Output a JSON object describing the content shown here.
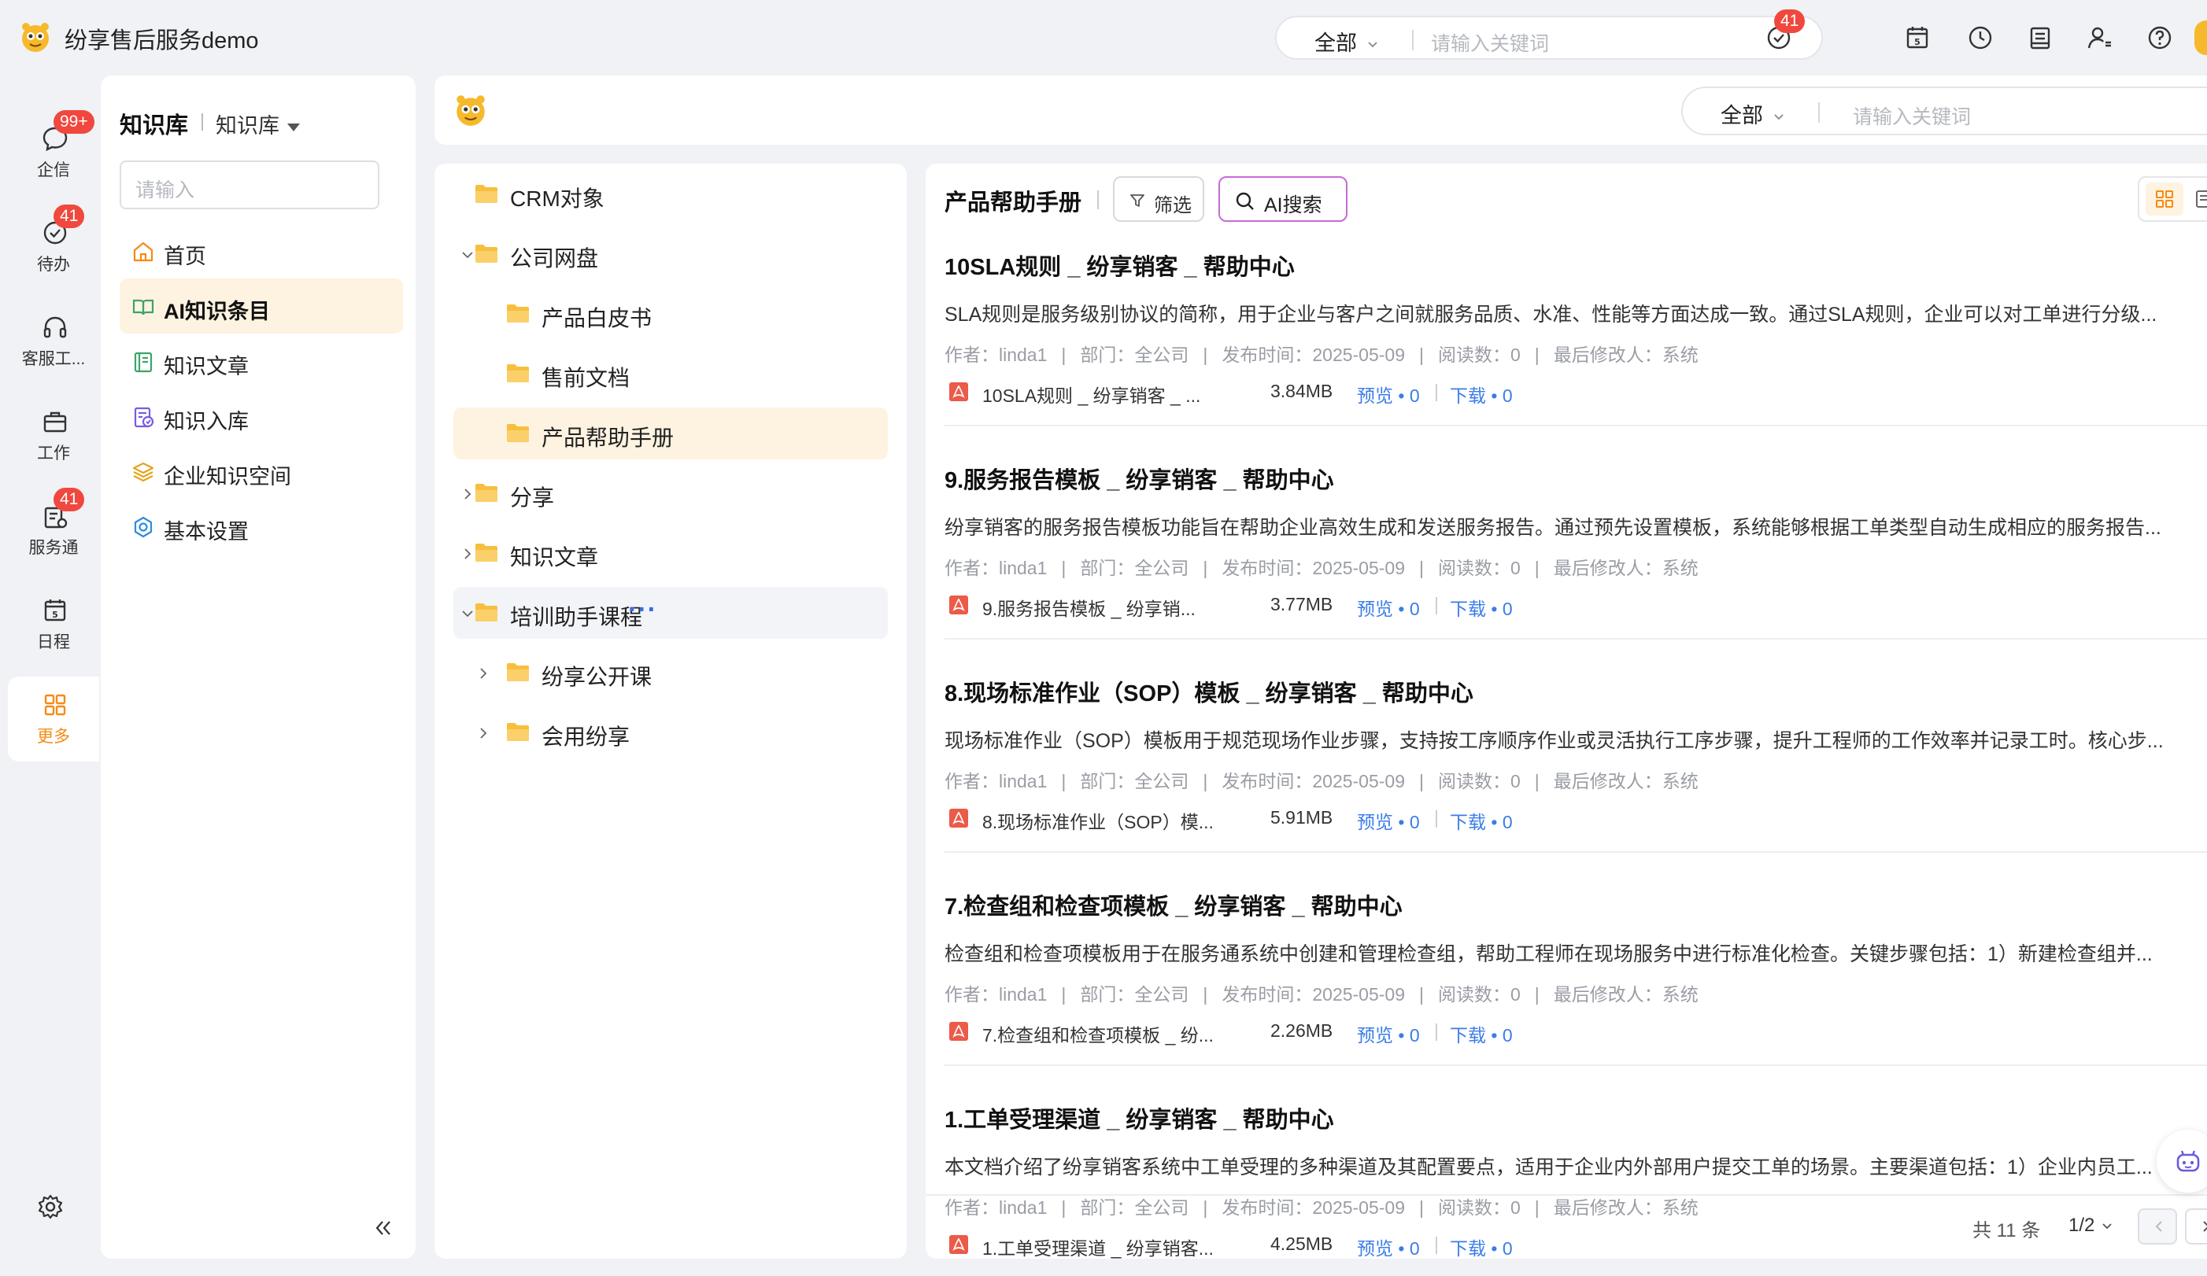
{
  "app": {
    "title": "纷享售后服务demo"
  },
  "top_search": {
    "scope": "全部",
    "placeholder": "请输入关键词"
  },
  "top_icons": [
    {
      "name": "todo-check-icon",
      "badge": "41"
    },
    {
      "name": "calendar-icon",
      "badge": ""
    },
    {
      "name": "clock-icon",
      "badge": ""
    },
    {
      "name": "notes-icon",
      "badge": ""
    },
    {
      "name": "user-settings-icon",
      "badge": ""
    },
    {
      "name": "help-icon",
      "badge": ""
    }
  ],
  "rail": [
    {
      "label": "企信",
      "icon": "chat-icon",
      "badge": "99+"
    },
    {
      "label": "待办",
      "icon": "todo-check-icon",
      "badge": "41"
    },
    {
      "label": "客服工...",
      "icon": "headset-icon",
      "badge": ""
    },
    {
      "label": "工作",
      "icon": "briefcase-icon",
      "badge": ""
    },
    {
      "label": "服务通",
      "icon": "service-icon",
      "badge": "41"
    },
    {
      "label": "日程",
      "icon": "calendar-icon",
      "badge": ""
    },
    {
      "label": "更多",
      "icon": "grid-icon",
      "badge": ""
    }
  ],
  "nav": {
    "title": "知识库",
    "subtitle": "知识库",
    "search_placeholder": "请输入",
    "items": [
      {
        "label": "首页",
        "icon": "home-icon"
      },
      {
        "label": "AI知识条目",
        "icon": "book-open-icon",
        "active": true
      },
      {
        "label": "知识文章",
        "icon": "article-icon"
      },
      {
        "label": "知识入库",
        "icon": "import-icon"
      },
      {
        "label": "企业知识空间",
        "icon": "layers-icon"
      },
      {
        "label": "基本设置",
        "icon": "settings-icon"
      }
    ]
  },
  "header_search": {
    "scope": "全部",
    "placeholder": "请输入关键词"
  },
  "tree": [
    {
      "label": "CRM对象",
      "level": 0,
      "caret": ""
    },
    {
      "label": "公司网盘",
      "level": 0,
      "caret": "down"
    },
    {
      "label": "产品白皮书",
      "level": 1,
      "caret": ""
    },
    {
      "label": "售前文档",
      "level": 1,
      "caret": ""
    },
    {
      "label": "产品帮助手册",
      "level": 1,
      "caret": "",
      "state": "active"
    },
    {
      "label": "分享",
      "level": 0,
      "caret": "right"
    },
    {
      "label": "知识文章",
      "level": 0,
      "caret": "right"
    },
    {
      "label": "培训助手课程",
      "level": 0,
      "caret": "down",
      "state": "hover",
      "more": "···"
    },
    {
      "label": "纷享公开课",
      "level": 1,
      "caret": "right"
    },
    {
      "label": "会用纷享",
      "level": 1,
      "caret": "right"
    }
  ],
  "list": {
    "title": "产品帮助手册",
    "filter_label": "筛选",
    "ai_label": "AI搜索",
    "meta_labels": {
      "author": "作者：",
      "dept": "部门：",
      "date": "发布时间：",
      "reads": "阅读数：",
      "modifier": "最后修改人：",
      "sep": "|"
    },
    "docs": [
      {
        "title": "10SLA规则 _ 纷享销客 _ 帮助中心",
        "summary": "SLA规则是服务级别协议的简称，用于企业与客户之间就服务品质、水准、性能等方面达成一致。通过SLA规则，企业可以对工单进行分级...",
        "author": "linda1",
        "dept": "全公司",
        "date": "2025-05-09",
        "reads": "0",
        "modifier": "系统",
        "file": "10SLA规则 _ 纷享销客 _ ...",
        "size": "3.84MB",
        "preview": "预览 • 0",
        "download": "下载 • 0"
      },
      {
        "title": "9.服务报告模板 _ 纷享销客 _ 帮助中心",
        "summary": "纷享销客的服务报告模板功能旨在帮助企业高效生成和发送服务报告。通过预先设置模板，系统能够根据工单类型自动生成相应的服务报告...",
        "author": "linda1",
        "dept": "全公司",
        "date": "2025-05-09",
        "reads": "0",
        "modifier": "系统",
        "file": "9.服务报告模板 _ 纷享销...",
        "size": "3.77MB",
        "preview": "预览 • 0",
        "download": "下载 • 0"
      },
      {
        "title": "8.现场标准作业（SOP）模板 _ 纷享销客 _ 帮助中心",
        "summary": "现场标准作业（SOP）模板用于规范现场作业步骤，支持按工序顺序作业或灵活执行工序步骤，提升工程师的工作效率并记录工时。核心步...",
        "author": "linda1",
        "dept": "全公司",
        "date": "2025-05-09",
        "reads": "0",
        "modifier": "系统",
        "file": "8.现场标准作业（SOP）模...",
        "size": "5.91MB",
        "preview": "预览 • 0",
        "download": "下载 • 0"
      },
      {
        "title": "7.检查组和检查项模板 _ 纷享销客 _ 帮助中心",
        "summary": "检查组和检查项模板用于在服务通系统中创建和管理检查组，帮助工程师在现场服务中进行标准化检查。关键步骤包括：1）新建检查组并...",
        "author": "linda1",
        "dept": "全公司",
        "date": "2025-05-09",
        "reads": "0",
        "modifier": "系统",
        "file": "7.检查组和检查项模板 _ 纷...",
        "size": "2.26MB",
        "preview": "预览 • 0",
        "download": "下载 • 0"
      },
      {
        "title": "1.工单受理渠道 _ 纷享销客 _ 帮助中心",
        "summary": "本文档介绍了纷享销客系统中工单受理的多种渠道及其配置要点，适用于企业内外部用户提交工单的场景。主要渠道包括：1）企业内员工...",
        "author": "linda1",
        "dept": "全公司",
        "date": "2025-05-09",
        "reads": "0",
        "modifier": "系统",
        "file": "1.工单受理渠道 _ 纷享销客...",
        "size": "4.25MB",
        "preview": "预览 • 0",
        "download": "下载 • 0"
      }
    ],
    "pager": {
      "total": "共 11 条",
      "page": "1/2"
    }
  },
  "colors": {
    "accent": "#f68a13",
    "link": "#3a7de8",
    "badge": "#f0483e",
    "active_bg": "#fef3e1"
  }
}
